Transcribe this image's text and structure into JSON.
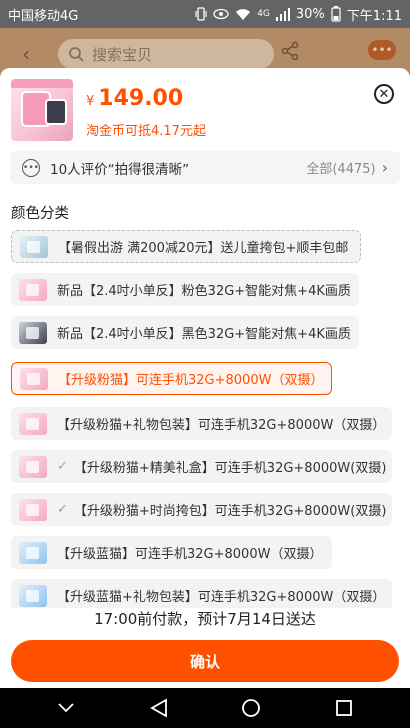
{
  "status_bar": {
    "carrier": "中国移动4G",
    "network": "4G",
    "battery": "30%",
    "time": "下午1:11"
  },
  "background_header": {
    "search_placeholder": "搜索宝贝"
  },
  "product": {
    "currency": "¥",
    "price": "149.00",
    "coin_text": "淘金币可抵4.17元起"
  },
  "review": {
    "text": "10人评价“拍得很清晰”",
    "all": "全部(4475)"
  },
  "section_title": "颜色分类",
  "options": [
    {
      "label": "【暑假出游 满200减20元】送儿童挎包+顺丰包邮",
      "thumb": "banner",
      "state": "dashed",
      "check": false
    },
    {
      "label": "新品【2.4吋小单反】粉色32G+智能对焦+4K画质",
      "thumb": "pink",
      "state": "normal",
      "check": false
    },
    {
      "label": "新品【2.4吋小单反】黑色32G+智能对焦+4K画质",
      "thumb": "dark",
      "state": "normal",
      "check": false
    },
    {
      "label": "【升级粉猫】可连手机32G+8000W（双摄）",
      "thumb": "pink",
      "state": "selected",
      "check": false
    },
    {
      "label": "【升级粉猫+礼物包装】可连手机32G+8000W（双摄）",
      "thumb": "pink",
      "state": "normal",
      "check": false
    },
    {
      "label": "【升级粉猫+精美礼盒】可连手机32G+8000W(双摄)",
      "thumb": "pink",
      "state": "normal",
      "check": true
    },
    {
      "label": "【升级粉猫+时尚挎包】可连手机32G+8000W(双摄)",
      "thumb": "pink",
      "state": "normal",
      "check": true
    },
    {
      "label": "【升级蓝猫】可连手机32G+8000W（双摄）",
      "thumb": "blue",
      "state": "normal",
      "check": false
    },
    {
      "label": "【升级蓝猫+礼物包装】可连手机32G+8000W（双摄）",
      "thumb": "blue",
      "state": "normal",
      "check": false
    }
  ],
  "delivery_text": "17:00前付款，预计7月14日送达",
  "confirm_label": "确认",
  "colors": {
    "accent": "#ff5000",
    "status_bar": "#646464",
    "option_bg": "#f3f3f3"
  }
}
